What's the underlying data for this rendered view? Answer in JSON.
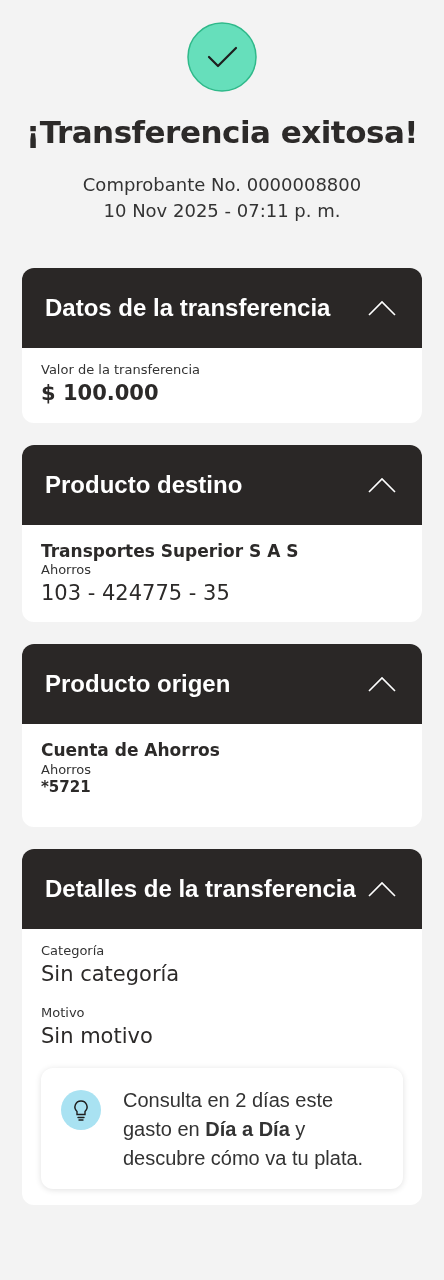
{
  "status": {
    "kind": "success"
  },
  "title": "¡Transferencia exitosa!",
  "receipt": "Comprobante No. 0000008800",
  "datetime": "10 Nov 2025 - 07:11 p. m.",
  "cards": [
    {
      "title": "Datos de la transferencia",
      "expanded": true,
      "lines": [
        {
          "kind": "caption",
          "text": "Valor de la transferencia"
        },
        {
          "kind": "amount",
          "text": "$ 100.000"
        }
      ]
    },
    {
      "title": "Producto destino",
      "expanded": true,
      "lines": [
        {
          "kind": "name",
          "text": "Transportes Superior S A S"
        },
        {
          "kind": "caption",
          "text": "Ahorros"
        },
        {
          "kind": "number",
          "text": "103 - 424775 - 35"
        }
      ]
    },
    {
      "title": "Producto origen",
      "expanded": true,
      "lines": [
        {
          "kind": "name",
          "text": "Cuenta de Ahorros"
        },
        {
          "kind": "caption",
          "text": "Ahorros"
        },
        {
          "kind": "short-number",
          "text": "*5721"
        }
      ]
    },
    {
      "title": "Detalles de la transferencia",
      "expanded": true,
      "lines": [
        {
          "kind": "caption",
          "text": "Categoría"
        },
        {
          "kind": "value",
          "text": "Sin categoría"
        },
        {
          "kind": "caption",
          "text": "Motivo"
        },
        {
          "kind": "value",
          "text": "Sin motivo"
        }
      ],
      "tip": {
        "text": "Consulta en 2 días este gasto en **Día a Día** y descubre cómo va tu plata."
      }
    }
  ]
}
